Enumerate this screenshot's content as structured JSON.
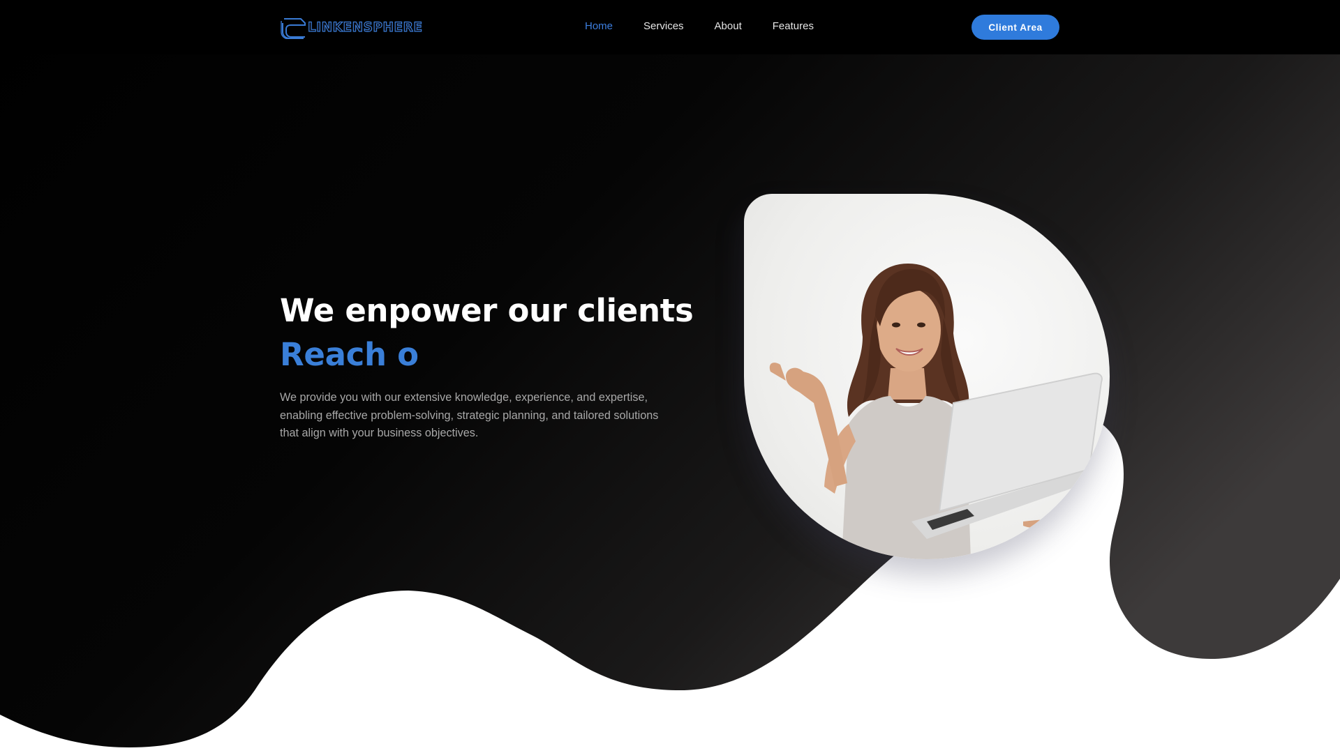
{
  "navbar": {
    "logo_text": "LINKENSPHERE",
    "links": [
      {
        "label": "Home",
        "active": true
      },
      {
        "label": "Services",
        "active": false
      },
      {
        "label": "About",
        "active": false
      },
      {
        "label": "Features",
        "active": false
      }
    ],
    "client_button": "Client Area"
  },
  "hero": {
    "title": "We enpower our clients",
    "typed_text": "Reach o",
    "description": "We provide you with our extensive knowledge, experience, and expertise, enabling effective problem-solving, strategic planning, and tailored solutions that align with your business objectives.",
    "image_icon": "woman-with-laptop-photo"
  },
  "colors": {
    "accent": "#2f7bdc",
    "nav_active": "#3d7fe0",
    "typed_text": "#3a7fd8",
    "background_dark": "#000000",
    "description_text": "#a8a8a8"
  }
}
